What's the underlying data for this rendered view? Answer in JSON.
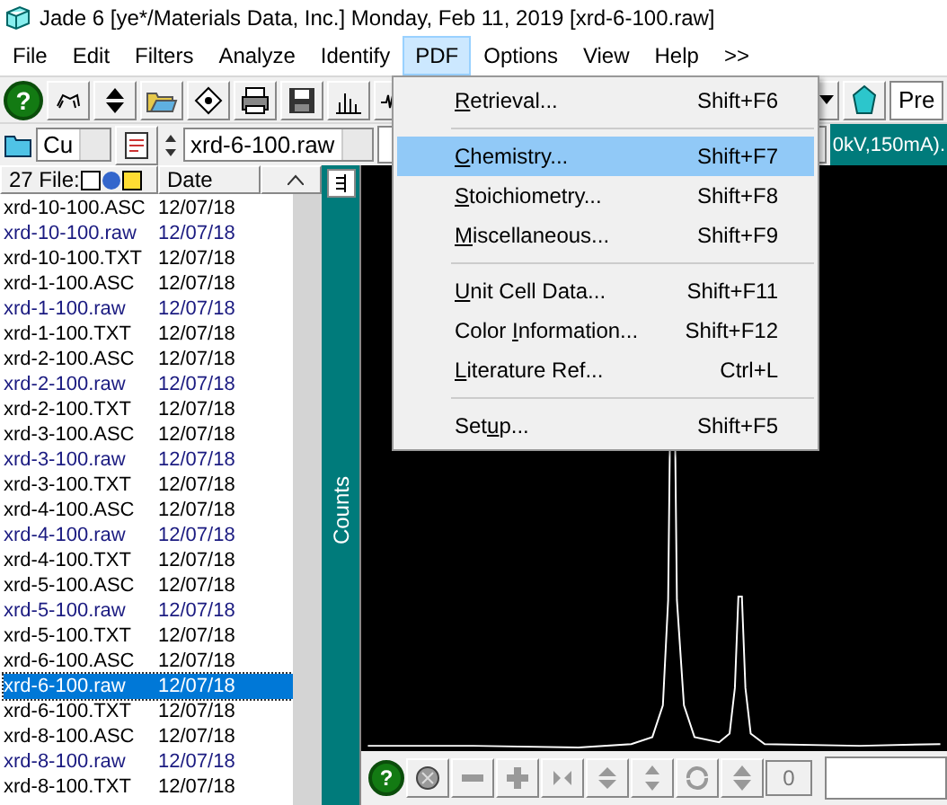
{
  "window": {
    "title": "Jade 6 [ye*/Materials Data, Inc.] Monday, Feb 11, 2019 [xrd-6-100.raw]"
  },
  "menubar": [
    {
      "label": "File",
      "selected": false
    },
    {
      "label": "Edit",
      "selected": false
    },
    {
      "label": "Filters",
      "selected": false
    },
    {
      "label": "Analyze",
      "selected": false
    },
    {
      "label": "Identify",
      "selected": false
    },
    {
      "label": "PDF",
      "selected": true
    },
    {
      "label": "Options",
      "selected": false
    },
    {
      "label": "View",
      "selected": false
    },
    {
      "label": "Help",
      "selected": false
    },
    {
      "label": ">>",
      "selected": false
    }
  ],
  "toolbar": {
    "help_label": "?",
    "preset_button": "Pre"
  },
  "toolbar2": {
    "element": "Cu",
    "file": "xrd-6-100.raw",
    "status": "0kV,150mA)."
  },
  "file_list": {
    "columns": [
      "27 File:",
      "Date"
    ],
    "rows": [
      {
        "name": "xrd-10-100.ASC",
        "date": "12/07/18",
        "kind": "text",
        "selected": false
      },
      {
        "name": "xrd-10-100.raw",
        "date": "12/07/18",
        "kind": "raw",
        "selected": false
      },
      {
        "name": "xrd-10-100.TXT",
        "date": "12/07/18",
        "kind": "text",
        "selected": false
      },
      {
        "name": "xrd-1-100.ASC",
        "date": "12/07/18",
        "kind": "text",
        "selected": false
      },
      {
        "name": "xrd-1-100.raw",
        "date": "12/07/18",
        "kind": "raw",
        "selected": false
      },
      {
        "name": "xrd-1-100.TXT",
        "date": "12/07/18",
        "kind": "text",
        "selected": false
      },
      {
        "name": "xrd-2-100.ASC",
        "date": "12/07/18",
        "kind": "text",
        "selected": false
      },
      {
        "name": "xrd-2-100.raw",
        "date": "12/07/18",
        "kind": "raw",
        "selected": false
      },
      {
        "name": "xrd-2-100.TXT",
        "date": "12/07/18",
        "kind": "text",
        "selected": false
      },
      {
        "name": "xrd-3-100.ASC",
        "date": "12/07/18",
        "kind": "text",
        "selected": false
      },
      {
        "name": "xrd-3-100.raw",
        "date": "12/07/18",
        "kind": "raw",
        "selected": false
      },
      {
        "name": "xrd-3-100.TXT",
        "date": "12/07/18",
        "kind": "text",
        "selected": false
      },
      {
        "name": "xrd-4-100.ASC",
        "date": "12/07/18",
        "kind": "text",
        "selected": false
      },
      {
        "name": "xrd-4-100.raw",
        "date": "12/07/18",
        "kind": "raw",
        "selected": false
      },
      {
        "name": "xrd-4-100.TXT",
        "date": "12/07/18",
        "kind": "text",
        "selected": false
      },
      {
        "name": "xrd-5-100.ASC",
        "date": "12/07/18",
        "kind": "text",
        "selected": false
      },
      {
        "name": "xrd-5-100.raw",
        "date": "12/07/18",
        "kind": "raw",
        "selected": false
      },
      {
        "name": "xrd-5-100.TXT",
        "date": "12/07/18",
        "kind": "text",
        "selected": false
      },
      {
        "name": "xrd-6-100.ASC",
        "date": "12/07/18",
        "kind": "text",
        "selected": false
      },
      {
        "name": "xrd-6-100.raw",
        "date": "12/07/18",
        "kind": "raw",
        "selected": true
      },
      {
        "name": "xrd-6-100.TXT",
        "date": "12/07/18",
        "kind": "text",
        "selected": false
      },
      {
        "name": "xrd-8-100.ASC",
        "date": "12/07/18",
        "kind": "text",
        "selected": false
      },
      {
        "name": "xrd-8-100.raw",
        "date": "12/07/18",
        "kind": "raw",
        "selected": false
      },
      {
        "name": "xrd-8-100.TXT",
        "date": "12/07/18",
        "kind": "text",
        "selected": false
      }
    ]
  },
  "plot": {
    "axis_label": "Counts",
    "bottom_field": "0"
  },
  "pdf_menu": {
    "items": [
      {
        "kind": "item",
        "key": "R",
        "after": "etrieval...",
        "shortcut": "Shift+F6",
        "selected": false
      },
      {
        "kind": "separator"
      },
      {
        "kind": "item",
        "key": "C",
        "after": "hemistry...",
        "shortcut": "Shift+F7",
        "selected": true
      },
      {
        "kind": "item",
        "key": "S",
        "after": "toichiometry...",
        "shortcut": "Shift+F8",
        "selected": false
      },
      {
        "kind": "item",
        "key": "M",
        "after": "iscellaneous...",
        "shortcut": "Shift+F9",
        "selected": false
      },
      {
        "kind": "separator"
      },
      {
        "kind": "item",
        "key": "U",
        "after": "nit Cell Data...",
        "shortcut": "Shift+F11",
        "selected": false
      },
      {
        "kind": "item",
        "before": "Color ",
        "key": "I",
        "after": "nformation...",
        "shortcut": "Shift+F12",
        "selected": false
      },
      {
        "kind": "item",
        "key": "L",
        "after": "iterature Ref...",
        "shortcut": "Ctrl+L",
        "selected": false
      },
      {
        "kind": "separator"
      },
      {
        "kind": "item",
        "before": "Set",
        "key": "u",
        "after": "p...",
        "shortcut": "Shift+F5",
        "selected": false
      }
    ]
  }
}
